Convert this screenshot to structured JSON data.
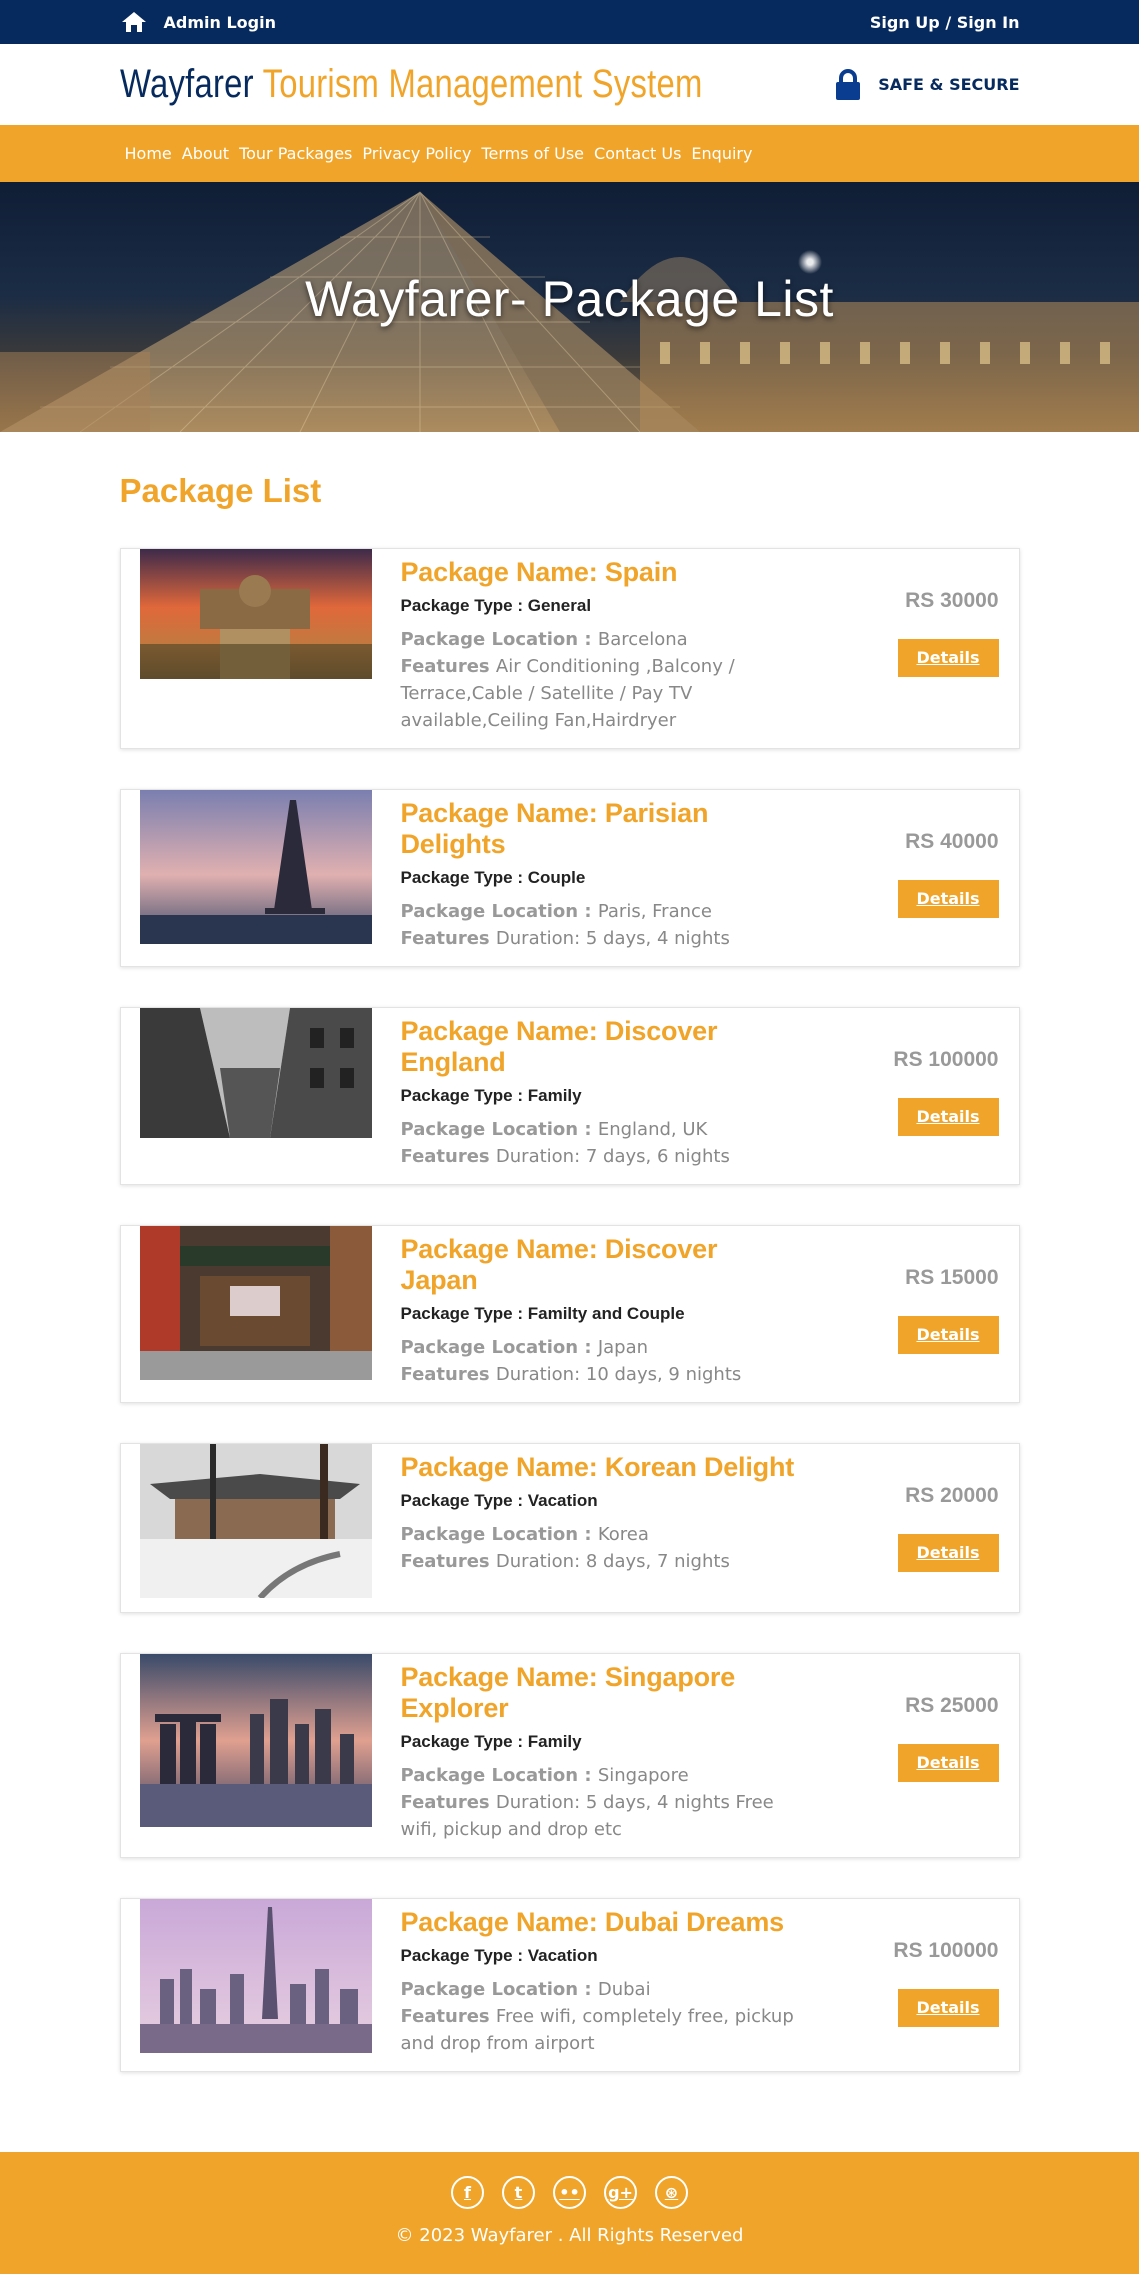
{
  "topbar": {
    "admin_login": "Admin Login",
    "signup_signin": "Sign Up / Sign In"
  },
  "header": {
    "brand_part1": "Wayfarer",
    "brand_part2": "Tourism Management System",
    "secure_label": "SAFE & SECURE"
  },
  "nav": [
    "Home",
    "About",
    "Tour Packages",
    "Privacy Policy",
    "Terms of Use",
    "Contact Us",
    "Enquiry"
  ],
  "banner": {
    "title": "Wayfarer- Package List"
  },
  "main": {
    "section_title": "Package List"
  },
  "labels": {
    "type": "Package Type : ",
    "location": "Package Location : ",
    "features": "Features ",
    "details": "Details"
  },
  "packages": [
    {
      "name": "Package Name: Spain",
      "type": "General",
      "location": "Barcelona",
      "features": "Air Conditioning ,Balcony / Terrace,Cable / Satellite / Pay TV available,Ceiling Fan,Hairdryer",
      "price": "RS 30000",
      "image": "spain-palace"
    },
    {
      "name": "Package Name: Parisian Delights",
      "type": "Couple",
      "location": "Paris, France",
      "features": "Duration: 5 days, 4 nights",
      "price": "RS 40000",
      "image": "eiffel-tower"
    },
    {
      "name": "Package Name: Discover England",
      "type": "Family",
      "location": "England, UK",
      "features": "Duration: 7 days, 6 nights",
      "price": "RS 100000",
      "image": "english-street"
    },
    {
      "name": "Package Name: Discover Japan",
      "type": "Familty and Couple",
      "location": "Japan",
      "features": "Duration: 10 days, 9 nights",
      "price": "RS 15000",
      "image": "japanese-shop"
    },
    {
      "name": "Package Name: Korean Delight",
      "type": "Vacation",
      "location": "Korea",
      "features": "Duration: 8 days, 7 nights",
      "price": "RS 20000",
      "image": "korean-palace-snow"
    },
    {
      "name": "Package Name: Singapore Explorer",
      "type": "Family",
      "location": "Singapore",
      "features": "Duration: 5 days, 4 nights Free wifi, pickup and drop etc",
      "price": "RS 25000",
      "image": "singapore-skyline"
    },
    {
      "name": "Package Name: Dubai Dreams",
      "type": "Vacation",
      "location": "Dubai",
      "features": "Free wifi, completely free, pickup and drop from airport",
      "price": "RS 100000",
      "image": "dubai-skyline"
    }
  ],
  "footer": {
    "copyright": "© 2023 Wayfarer . All Rights Reserved",
    "socials": [
      "facebook-icon",
      "twitter-icon",
      "flickr-icon",
      "googleplus-icon",
      "dribbble-icon"
    ]
  }
}
